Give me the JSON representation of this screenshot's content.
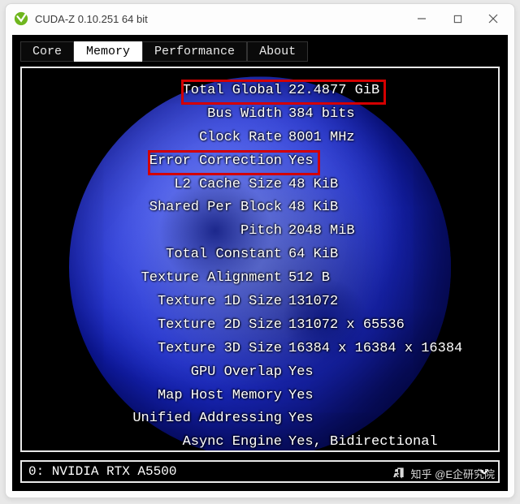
{
  "window": {
    "title": "CUDA-Z 0.10.251 64 bit"
  },
  "tabs": [
    {
      "label": "Core",
      "active": false
    },
    {
      "label": "Memory",
      "active": true
    },
    {
      "label": "Performance",
      "active": false
    },
    {
      "label": "About",
      "active": false
    }
  ],
  "memory_rows": [
    {
      "label": "Total Global",
      "value": "22.4877 GiB",
      "highlight": true
    },
    {
      "label": "Bus Width",
      "value": "384 bits",
      "highlight": false
    },
    {
      "label": "Clock Rate",
      "value": "8001 MHz",
      "highlight": false
    },
    {
      "label": "Error Correction",
      "value": "Yes",
      "highlight": true
    },
    {
      "label": "L2 Cache Size",
      "value": "48 KiB",
      "highlight": false
    },
    {
      "label": "Shared Per Block",
      "value": "48 KiB",
      "highlight": false
    },
    {
      "label": "Pitch",
      "value": "2048 MiB",
      "highlight": false
    },
    {
      "label": "Total Constant",
      "value": "64 KiB",
      "highlight": false
    },
    {
      "label": "Texture Alignment",
      "value": "512 B",
      "highlight": false
    },
    {
      "label": "Texture 1D Size",
      "value": "131072",
      "highlight": false
    },
    {
      "label": "Texture 2D Size",
      "value": "131072 x 65536",
      "highlight": false
    },
    {
      "label": "Texture 3D Size",
      "value": "16384 x 16384 x 16384",
      "highlight": false
    },
    {
      "label": "GPU Overlap",
      "value": "Yes",
      "highlight": false
    },
    {
      "label": "Map Host Memory",
      "value": "Yes",
      "highlight": false
    },
    {
      "label": "Unified Addressing",
      "value": "Yes",
      "highlight": false
    },
    {
      "label": "Async Engine",
      "value": "Yes, Bidirectional",
      "highlight": false
    }
  ],
  "device_selector": {
    "value": "0: NVIDIA RTX A5500"
  },
  "watermark": "知乎 @E企研究院"
}
